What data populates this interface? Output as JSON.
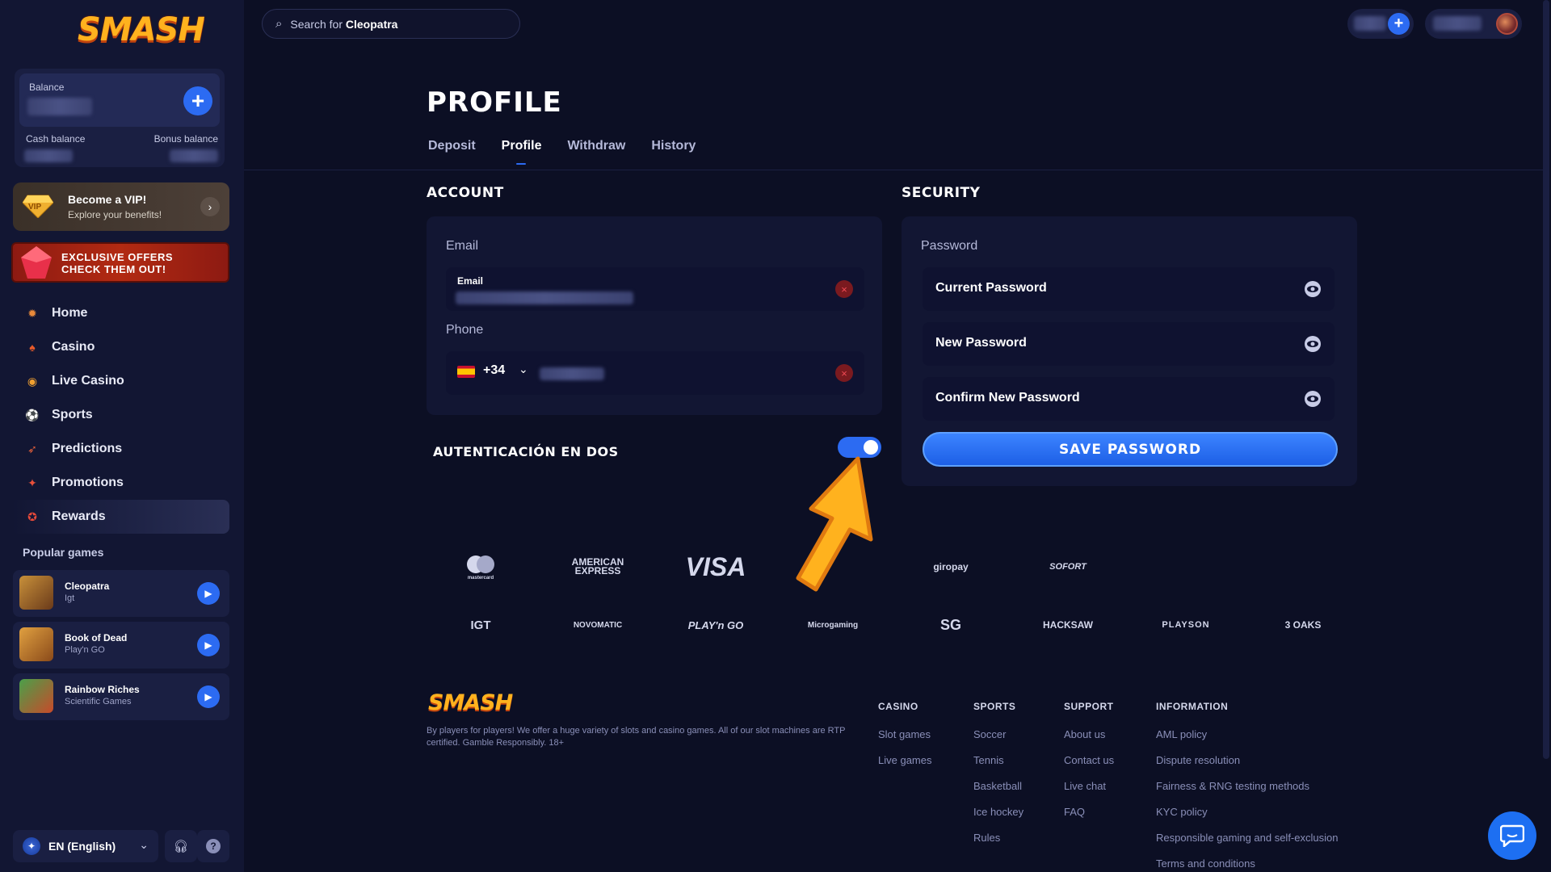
{
  "brand": {
    "logo_text": "SMASH",
    "accent": "#2c6bf2",
    "logo_color": "#ffb21e"
  },
  "balance": {
    "label": "Balance",
    "cash_label": "Cash balance",
    "bonus_label": "Bonus balance",
    "add_icon": "plus-icon"
  },
  "vip": {
    "title": "Become a VIP!",
    "subtitle": "Explore your benefits!",
    "badge": "VIP"
  },
  "offers": {
    "line1": "EXCLUSIVE OFFERS",
    "line2": "CHECK THEM OUT!"
  },
  "nav": {
    "items": [
      {
        "label": "Home",
        "icon": "home-icon",
        "glyph": "✹",
        "color": "#e8893a"
      },
      {
        "label": "Casino",
        "icon": "spade-icon",
        "glyph": "♠",
        "color": "#e85a2a"
      },
      {
        "label": "Live Casino",
        "icon": "chip-icon",
        "glyph": "◉",
        "color": "#f0a030"
      },
      {
        "label": "Sports",
        "icon": "ball-icon",
        "glyph": "⚽",
        "color": "#8a8fb8"
      },
      {
        "label": "Predictions",
        "icon": "target-icon",
        "glyph": "➶",
        "color": "#e8603a"
      },
      {
        "label": "Promotions",
        "icon": "promo-icon",
        "glyph": "✦",
        "color": "#e8503a"
      },
      {
        "label": "Rewards",
        "icon": "medal-icon",
        "glyph": "✪",
        "color": "#e84a3a"
      }
    ]
  },
  "popular": {
    "title": "Popular games",
    "games": [
      {
        "name": "Cleopatra",
        "provider": "Igt"
      },
      {
        "name": "Book of Dead",
        "provider": "Play'n GO"
      },
      {
        "name": "Rainbow Riches",
        "provider": "Scientific Games"
      }
    ]
  },
  "language": {
    "label": "EN (English)"
  },
  "search": {
    "prefix": "Search for",
    "term": "Cleopatra"
  },
  "page": {
    "title": "PROFILE"
  },
  "tabs": [
    {
      "label": "Deposit",
      "active": false
    },
    {
      "label": "Profile",
      "active": true
    },
    {
      "label": "Withdraw",
      "active": false
    },
    {
      "label": "History",
      "active": false
    }
  ],
  "account": {
    "title": "ACCOUNT",
    "email_section": "Email",
    "email_field_label": "Email",
    "phone_section": "Phone",
    "phone_code": "+34"
  },
  "two_factor": {
    "label": "AUTENTICACIÓN EN DOS",
    "enabled": true
  },
  "security": {
    "title": "SECURITY",
    "password_section": "Password",
    "current": "Current Password",
    "new": "New Password",
    "confirm": "Confirm New Password",
    "save": "SAVE PASSWORD"
  },
  "payment_logos": [
    "mastercard",
    "AMERICAN EXPRESS",
    "VISA",
    "giropay",
    "SOFORT"
  ],
  "provider_logos": [
    "IGT",
    "NOVOMATIC",
    "PLAY'n GO",
    "Microgaming",
    "SG",
    "HACKSAW",
    "PLAYSON",
    "3 OAKS"
  ],
  "footer": {
    "description": "By players for players! We offer a huge variety of slots and casino games. All of our slot machines are RTP certified. Gamble Responsibly. 18+",
    "columns": [
      {
        "head": "CASINO",
        "links": [
          "Slot games",
          "Live games"
        ]
      },
      {
        "head": "SPORTS",
        "links": [
          "Soccer",
          "Tennis",
          "Basketball",
          "Ice hockey",
          "Rules"
        ]
      },
      {
        "head": "SUPPORT",
        "links": [
          "About us",
          "Contact us",
          "Live chat",
          "FAQ"
        ]
      },
      {
        "head": "INFORMATION",
        "links": [
          "AML policy",
          "Dispute resolution",
          "Fairness & RNG testing methods",
          "KYC policy",
          "Responsible gaming and self-exclusion",
          "Terms and conditions"
        ]
      }
    ]
  }
}
